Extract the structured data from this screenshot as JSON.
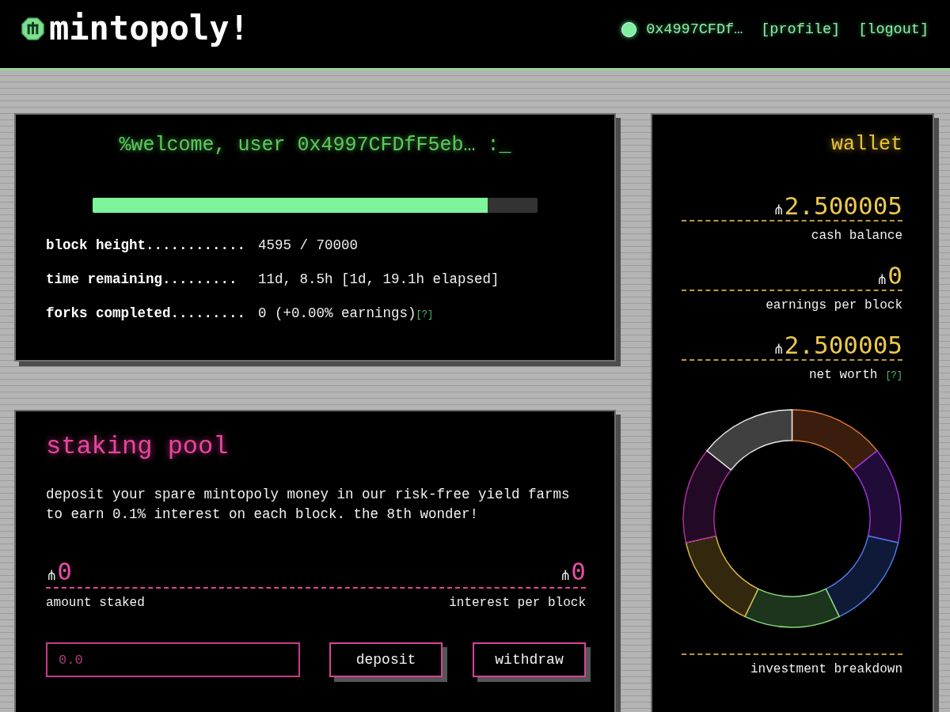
{
  "header": {
    "logo": "mintopoly!",
    "address": "0x4997CFDf…",
    "links": [
      "[profile]",
      "[logout]"
    ]
  },
  "welcome": {
    "greeting": "%welcome, user 0x4997CFDfF5eb… :_",
    "progress": {
      "level": 0.888
    },
    "stats": [
      {
        "label": "block height............",
        "value": "4595 / 70000"
      },
      {
        "label": "time remaining.........",
        "value": "11d, 8.5h [1d, 19.1h elapsed]"
      },
      {
        "label": "forks completed.........",
        "value": "0 (+0.00% earnings)",
        "help": "[?]"
      }
    ]
  },
  "staking": {
    "title": "staking pool",
    "description": "deposit your spare mintopoly money in our risk-free yield farms to earn 0.1% interest on each block. the 8th wonder!",
    "stats": [
      {
        "symbol": "⋔",
        "amount": "0",
        "label": "amount staked"
      },
      {
        "symbol": "⋔",
        "amount": "0",
        "label": "interest per block"
      }
    ],
    "amount_field": {
      "placeholder": "0.0"
    },
    "buttons": [
      "deposit",
      "withdraw"
    ]
  },
  "wallet": {
    "title": "wallet",
    "balances": [
      {
        "symbol": "⋔",
        "amount": "2.500005",
        "label": "cash balance"
      },
      {
        "symbol": "⋔",
        "amount": "0",
        "label": "earnings per block"
      },
      {
        "symbol": "⋔",
        "amount": "2.500005",
        "label": "net worth",
        "help": "[?]"
      }
    ],
    "breakdown_label": "investment breakdown"
  }
}
